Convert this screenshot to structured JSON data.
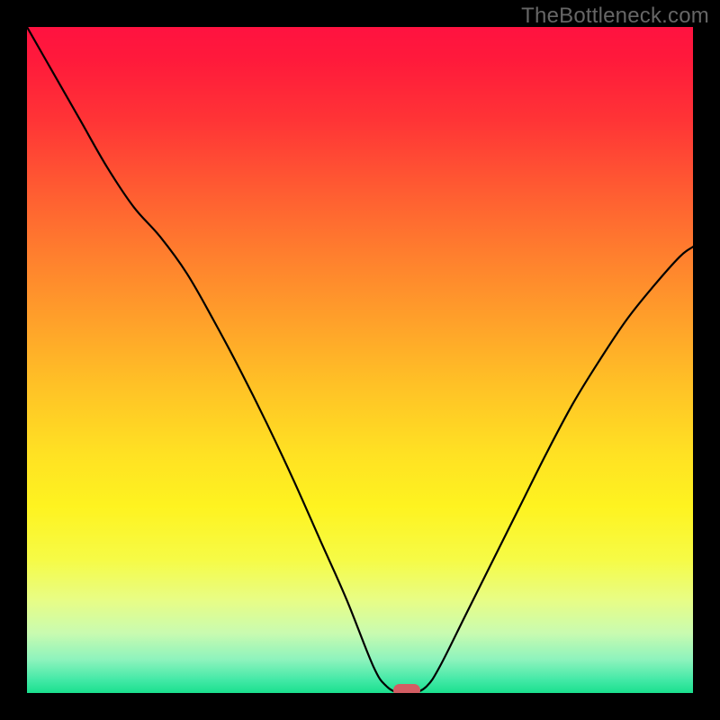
{
  "watermark": "TheBottleneck.com",
  "colors": {
    "bg": "#000000",
    "watermark": "#666666",
    "curve": "#000000",
    "marker": "#d35d63"
  },
  "chart_data": {
    "type": "line",
    "title": "",
    "xlabel": "",
    "ylabel": "",
    "xlim": [
      0,
      100
    ],
    "ylim": [
      0,
      100
    ],
    "series": [
      {
        "name": "bottleneck-curve",
        "x": [
          0,
          4,
          8,
          12,
          16,
          20,
          24,
          28,
          32,
          36,
          40,
          44,
          48,
          52,
          54,
          56,
          58,
          60,
          62,
          66,
          70,
          74,
          78,
          82,
          86,
          90,
          94,
          98,
          100
        ],
        "y": [
          100,
          93,
          86,
          79,
          73,
          68.5,
          63,
          56,
          48.5,
          40.5,
          32,
          23,
          14,
          4,
          1,
          0,
          0,
          1,
          4,
          12,
          20,
          28,
          36,
          43.5,
          50,
          56,
          61,
          65.5,
          67
        ]
      }
    ],
    "marker": {
      "x": 57,
      "y": 0
    },
    "gradient_stops": [
      {
        "pct": 0,
        "c": "#ff1240"
      },
      {
        "pct": 14,
        "c": "#ff3436"
      },
      {
        "pct": 34,
        "c": "#ff7e2e"
      },
      {
        "pct": 54,
        "c": "#ffc226"
      },
      {
        "pct": 72,
        "c": "#fef320"
      },
      {
        "pct": 86,
        "c": "#e8fd85"
      },
      {
        "pct": 95,
        "c": "#8df3bd"
      },
      {
        "pct": 100,
        "c": "#1ae08e"
      }
    ]
  }
}
